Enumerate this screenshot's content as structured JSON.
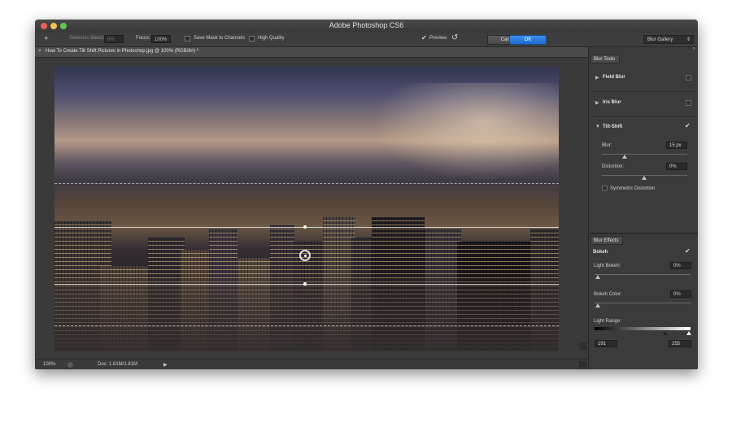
{
  "window": {
    "title": "Adobe Photoshop CS6"
  },
  "options_bar": {
    "selection_bleed_label": "Selection Bleed:",
    "selection_bleed_value": "0%",
    "focus_label": "Focus:",
    "focus_value": "100%",
    "save_mask_label": "Save Mask to Channels",
    "high_quality_label": "High Quality",
    "preview_label": "Preview",
    "cancel_label": "Cancel",
    "ok_label": "OK",
    "workspace_value": "Blur Gallery",
    "preview_checked": true,
    "save_mask_checked": false,
    "high_quality_checked": false
  },
  "document": {
    "tab_title": "How To Create Tilt Shift Pictures in Photoshop.jpg @ 100% (RGB/8#) *",
    "close_symbol": "×"
  },
  "status_bar": {
    "zoom": "100%",
    "doc_info": "Doc: 1.61M/1.61M"
  },
  "blur_tools": {
    "panel_title": "Blur Tools",
    "field_blur": {
      "label": "Field Blur",
      "enabled": false
    },
    "iris_blur": {
      "label": "Iris Blur",
      "enabled": false
    },
    "tilt_shift": {
      "label": "Tilt-Shift",
      "enabled": true,
      "blur_label": "Blur:",
      "blur_value": "15 px",
      "blur_fraction": 0.2,
      "distortion_label": "Distortion:",
      "distortion_value": "0%",
      "distortion_fraction": 0.5,
      "symmetric_label": "Symmetric Distortion",
      "symmetric_checked": false
    }
  },
  "blur_effects": {
    "panel_title": "Blur Effects",
    "bokeh_label": "Bokeh",
    "bokeh_enabled": true,
    "light_bokeh_label": "Light Bokeh:",
    "light_bokeh_value": "0%",
    "light_bokeh_fraction": 0.0,
    "bokeh_color_label": "Bokeh Color:",
    "bokeh_color_value": "0%",
    "bokeh_color_fraction": 0.0,
    "light_range_label": "Light Range:",
    "light_range_low": "191",
    "light_range_high": "255"
  },
  "colors": {
    "ok_button": "#1f6bd0",
    "panel_bg": "#3b3b3b",
    "canvas_bg": "#3a3a3a"
  },
  "icons": {
    "checkmark": "✔",
    "expand": "▶",
    "collapse": "▼",
    "reset": "↺"
  }
}
